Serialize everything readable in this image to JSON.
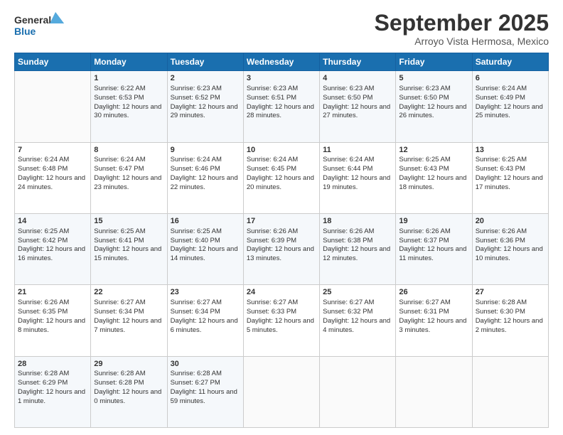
{
  "header": {
    "logo_general": "General",
    "logo_blue": "Blue",
    "month_title": "September 2025",
    "location": "Arroyo Vista Hermosa, Mexico"
  },
  "days_of_week": [
    "Sunday",
    "Monday",
    "Tuesday",
    "Wednesday",
    "Thursday",
    "Friday",
    "Saturday"
  ],
  "weeks": [
    [
      {
        "day": null
      },
      {
        "day": 1,
        "sunrise": "6:22 AM",
        "sunset": "6:53 PM",
        "daylight": "12 hours and 30 minutes."
      },
      {
        "day": 2,
        "sunrise": "6:23 AM",
        "sunset": "6:52 PM",
        "daylight": "12 hours and 29 minutes."
      },
      {
        "day": 3,
        "sunrise": "6:23 AM",
        "sunset": "6:51 PM",
        "daylight": "12 hours and 28 minutes."
      },
      {
        "day": 4,
        "sunrise": "6:23 AM",
        "sunset": "6:50 PM",
        "daylight": "12 hours and 27 minutes."
      },
      {
        "day": 5,
        "sunrise": "6:23 AM",
        "sunset": "6:50 PM",
        "daylight": "12 hours and 26 minutes."
      },
      {
        "day": 6,
        "sunrise": "6:24 AM",
        "sunset": "6:49 PM",
        "daylight": "12 hours and 25 minutes."
      }
    ],
    [
      {
        "day": 7,
        "sunrise": "6:24 AM",
        "sunset": "6:48 PM",
        "daylight": "12 hours and 24 minutes."
      },
      {
        "day": 8,
        "sunrise": "6:24 AM",
        "sunset": "6:47 PM",
        "daylight": "12 hours and 23 minutes."
      },
      {
        "day": 9,
        "sunrise": "6:24 AM",
        "sunset": "6:46 PM",
        "daylight": "12 hours and 22 minutes."
      },
      {
        "day": 10,
        "sunrise": "6:24 AM",
        "sunset": "6:45 PM",
        "daylight": "12 hours and 20 minutes."
      },
      {
        "day": 11,
        "sunrise": "6:24 AM",
        "sunset": "6:44 PM",
        "daylight": "12 hours and 19 minutes."
      },
      {
        "day": 12,
        "sunrise": "6:25 AM",
        "sunset": "6:43 PM",
        "daylight": "12 hours and 18 minutes."
      },
      {
        "day": 13,
        "sunrise": "6:25 AM",
        "sunset": "6:43 PM",
        "daylight": "12 hours and 17 minutes."
      }
    ],
    [
      {
        "day": 14,
        "sunrise": "6:25 AM",
        "sunset": "6:42 PM",
        "daylight": "12 hours and 16 minutes."
      },
      {
        "day": 15,
        "sunrise": "6:25 AM",
        "sunset": "6:41 PM",
        "daylight": "12 hours and 15 minutes."
      },
      {
        "day": 16,
        "sunrise": "6:25 AM",
        "sunset": "6:40 PM",
        "daylight": "12 hours and 14 minutes."
      },
      {
        "day": 17,
        "sunrise": "6:26 AM",
        "sunset": "6:39 PM",
        "daylight": "12 hours and 13 minutes."
      },
      {
        "day": 18,
        "sunrise": "6:26 AM",
        "sunset": "6:38 PM",
        "daylight": "12 hours and 12 minutes."
      },
      {
        "day": 19,
        "sunrise": "6:26 AM",
        "sunset": "6:37 PM",
        "daylight": "12 hours and 11 minutes."
      },
      {
        "day": 20,
        "sunrise": "6:26 AM",
        "sunset": "6:36 PM",
        "daylight": "12 hours and 10 minutes."
      }
    ],
    [
      {
        "day": 21,
        "sunrise": "6:26 AM",
        "sunset": "6:35 PM",
        "daylight": "12 hours and 8 minutes."
      },
      {
        "day": 22,
        "sunrise": "6:27 AM",
        "sunset": "6:34 PM",
        "daylight": "12 hours and 7 minutes."
      },
      {
        "day": 23,
        "sunrise": "6:27 AM",
        "sunset": "6:34 PM",
        "daylight": "12 hours and 6 minutes."
      },
      {
        "day": 24,
        "sunrise": "6:27 AM",
        "sunset": "6:33 PM",
        "daylight": "12 hours and 5 minutes."
      },
      {
        "day": 25,
        "sunrise": "6:27 AM",
        "sunset": "6:32 PM",
        "daylight": "12 hours and 4 minutes."
      },
      {
        "day": 26,
        "sunrise": "6:27 AM",
        "sunset": "6:31 PM",
        "daylight": "12 hours and 3 minutes."
      },
      {
        "day": 27,
        "sunrise": "6:28 AM",
        "sunset": "6:30 PM",
        "daylight": "12 hours and 2 minutes."
      }
    ],
    [
      {
        "day": 28,
        "sunrise": "6:28 AM",
        "sunset": "6:29 PM",
        "daylight": "12 hours and 1 minute."
      },
      {
        "day": 29,
        "sunrise": "6:28 AM",
        "sunset": "6:28 PM",
        "daylight": "12 hours and 0 minutes."
      },
      {
        "day": 30,
        "sunrise": "6:28 AM",
        "sunset": "6:27 PM",
        "daylight": "11 hours and 59 minutes."
      },
      {
        "day": null
      },
      {
        "day": null
      },
      {
        "day": null
      },
      {
        "day": null
      }
    ]
  ]
}
